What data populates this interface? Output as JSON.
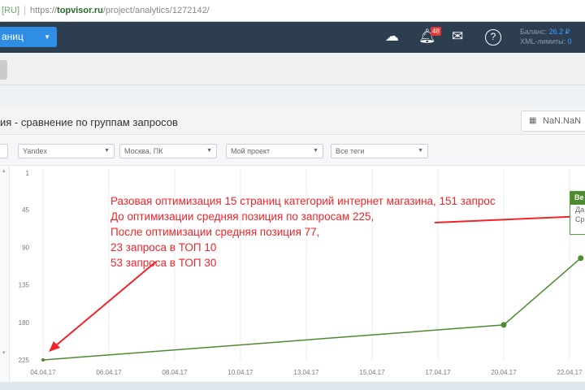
{
  "browser": {
    "locale": "[RU]",
    "url_scheme": "https://",
    "url_host": "topvisor.ru",
    "url_path": "/project/analytics/1272142/"
  },
  "nav": {
    "dropdown_label": "аниц",
    "notifications_count": "48",
    "balance_label": "Баланс:",
    "balance_value": "26.2 ₽",
    "xml_label": "XML-лимиты:",
    "xml_value": "0"
  },
  "page": {
    "title": "ия - сравнение по группам запросов",
    "date_button": "NaN.NaN"
  },
  "filters": [
    "Yandex",
    "Москва, ПК",
    "Мой проект",
    "Все теги"
  ],
  "annotation": [
    "Разовая оптимизация 15 страниц категорий интернет магазина, 151 запрос",
    "До оптимизации средняя позиция по запросам 225,",
    "После оптимизации средняя позиция 77,",
    "23 запроса в ТОП 10",
    "53 запроса в ТОП 30"
  ],
  "tooltip": {
    "header": "Ве",
    "line1": "Да",
    "line2": "Ср"
  },
  "colors": {
    "line": "#4e8a2e",
    "annotation": "#f2242a",
    "accent": "#2f8de4"
  },
  "chart_data": {
    "type": "line",
    "categories": [
      "04.04.17",
      "06.04.17",
      "08.04.17",
      "10.04.17",
      "13.04.17",
      "15.04.17",
      "17.04.17",
      "20.04.17",
      "22.04.17"
    ],
    "y_ticks": [
      1,
      45,
      90,
      135,
      180,
      225
    ],
    "ylim": [
      1,
      225
    ],
    "y_inverted": true,
    "series": [
      {
        "name": "Средняя позиция",
        "points": [
          {
            "x": 0,
            "y": 225
          },
          {
            "x": 7,
            "y": 183
          },
          {
            "x": 8.17,
            "y": 103
          }
        ]
      }
    ]
  }
}
